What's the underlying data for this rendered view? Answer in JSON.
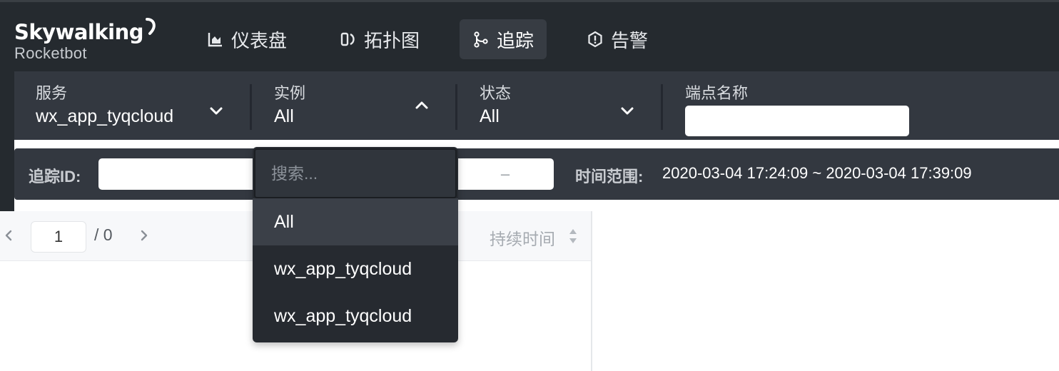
{
  "app": {
    "logo_main": "Skywalking",
    "logo_sub": "Rocketbot"
  },
  "nav": {
    "items": [
      {
        "label": "仪表盘",
        "icon": "chart-icon",
        "active": false
      },
      {
        "label": "拓扑图",
        "icon": "topology-icon",
        "active": false
      },
      {
        "label": "追踪",
        "icon": "trace-icon",
        "active": true
      },
      {
        "label": "告警",
        "icon": "alarm-icon",
        "active": false
      }
    ]
  },
  "filters": {
    "service": {
      "label": "服务",
      "value": "wx_app_tyqcloud"
    },
    "instance": {
      "label": "实例",
      "value": "All"
    },
    "status": {
      "label": "状态",
      "value": "All"
    },
    "endpoint": {
      "label": "端点名称",
      "value": ""
    }
  },
  "query": {
    "trace_id_label": "追踪ID:",
    "trace_id_value": "",
    "duration_separator": "–",
    "time_range_label": "时间范围:",
    "time_range_value": "2020-03-04 17:24:09 ~ 2020-03-04 17:39:09"
  },
  "dropdown": {
    "search_placeholder": "搜索...",
    "options": [
      "All",
      "wx_app_tyqcloud",
      "wx_app_tyqcloud"
    ],
    "selected_index": 0
  },
  "list": {
    "page_current": "1",
    "page_total": "/ 0",
    "sort_label": "持续时间"
  }
}
